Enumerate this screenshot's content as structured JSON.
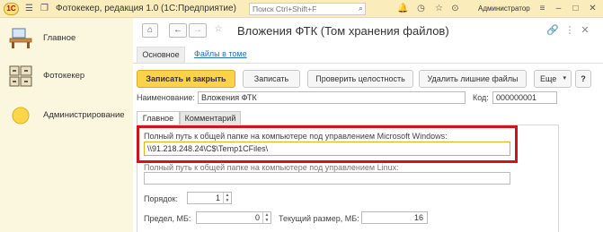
{
  "titlebar": {
    "logo": "1С",
    "app_title": "Фотокекер, редакция 1.0  (1С:Предприятие)",
    "search_placeholder": "Поиск Ctrl+Shift+F",
    "user": "Администратор"
  },
  "sidebar": {
    "items": [
      {
        "label": "Главное",
        "icon": "home-desk-icon"
      },
      {
        "label": "Фотокекер",
        "icon": "photo-cabinet-icon"
      },
      {
        "label": "Администрирование",
        "icon": "admin-sun-icon"
      }
    ]
  },
  "form": {
    "title": "Вложения ФТК (Том хранения файлов)",
    "tabs": {
      "main": "Основное",
      "files_link": "Файлы в томе"
    },
    "commands": {
      "save_close": "Записать и закрыть",
      "save": "Записать",
      "check": "Проверить целостность",
      "delete_extra": "Удалить лишние файлы",
      "more": "Еще"
    },
    "name_label": "Наименование:",
    "name_value": "Вложения ФТК",
    "code_label": "Код:",
    "code_value": "000000001",
    "inner_tabs": {
      "main": "Главное",
      "comment": "Комментарий"
    },
    "windows_path_label": "Полный путь к общей папке на компьютере под управлением Microsoft Windows:",
    "windows_path_value": "\\\\91.218.248.24\\C$\\Temp1CFiles\\",
    "linux_path_label": "Полный путь к общей папке на компьютере под управлением Linux:",
    "linux_path_value": "",
    "order_label": "Порядок:",
    "order_value": "1",
    "limit_label": "Предел, МБ:",
    "limit_value": "0",
    "current_size_label": "Текущий размер, МБ:",
    "current_size_value": "16"
  },
  "colors": {
    "titlebar": "#fbecbc",
    "sidebar": "#fbf6de",
    "primary_button": "#fbd34b",
    "highlight_box": "#d0141b",
    "link": "#2d6fb8"
  }
}
